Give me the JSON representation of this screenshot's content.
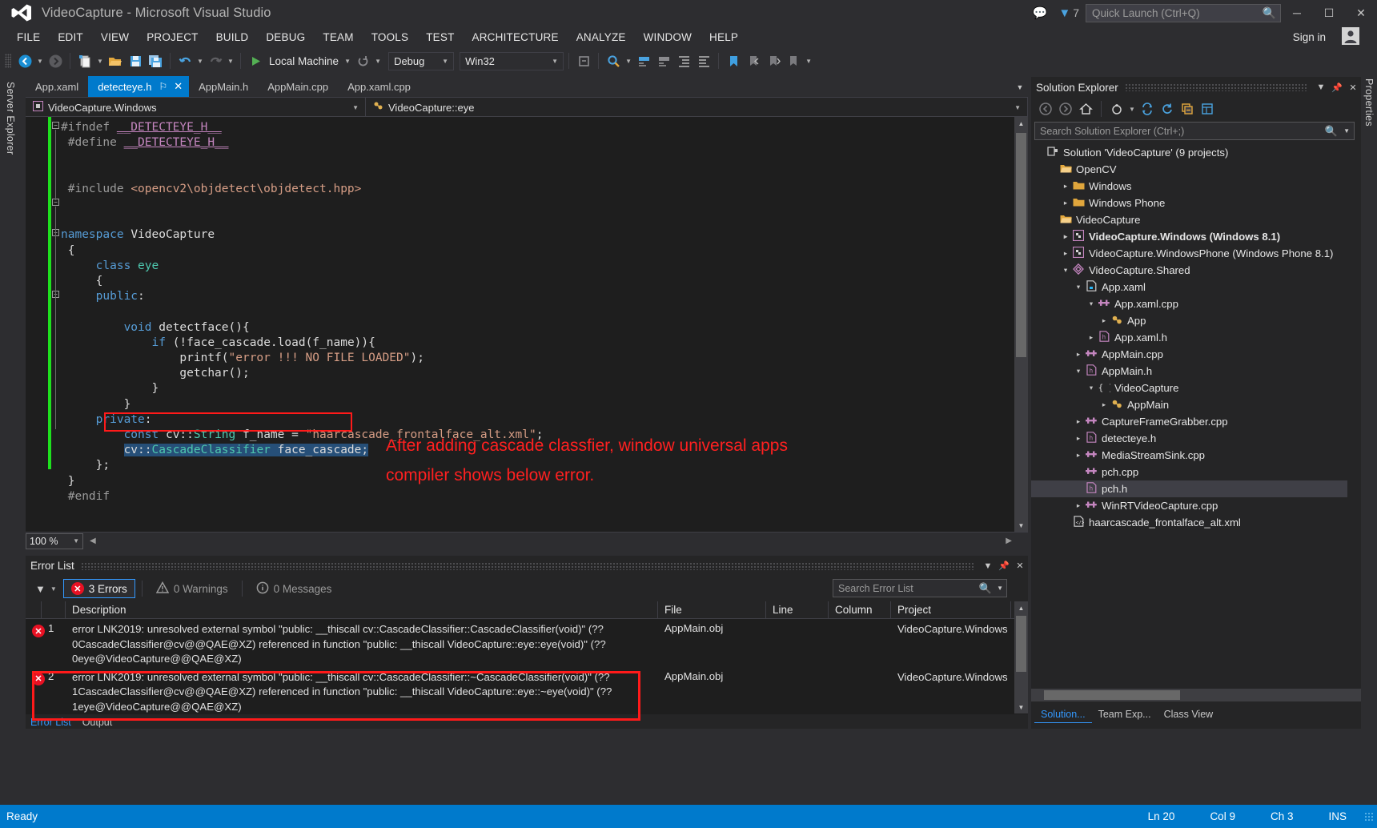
{
  "window": {
    "title": "VideoCapture - Microsoft Visual Studio",
    "logo_icon": "visual-studio-logo",
    "feedback_icon": "feedback-icon",
    "notification_icon": "notification-funnel-icon",
    "notification_count": "7",
    "minimize": "─",
    "maximize": "☐",
    "close": "✕",
    "sign_in": "Sign in",
    "user_icon": "user-account-icon"
  },
  "quick_launch": {
    "placeholder": "Quick Launch (Ctrl+Q)",
    "search_icon": "magnifier-icon"
  },
  "menu": {
    "items": [
      "FILE",
      "EDIT",
      "VIEW",
      "PROJECT",
      "BUILD",
      "DEBUG",
      "TEAM",
      "TOOLS",
      "TEST",
      "ARCHITECTURE",
      "ANALYZE",
      "WINDOW",
      "HELP"
    ]
  },
  "toolbar": {
    "nav_back_icon": "navigate-back-icon",
    "nav_forward_icon": "navigate-forward-icon",
    "new_project_icon": "new-project-icon",
    "open_file_icon": "open-file-icon",
    "save_icon": "save-icon",
    "save_all_icon": "save-all-icon",
    "undo_icon": "undo-icon",
    "redo_icon": "redo-icon",
    "start_icon": "start-debug-play-icon",
    "start_label": "Local Machine",
    "restart_icon": "restart-icon",
    "config_value": "Debug",
    "platform_value": "Win32",
    "step_icon": "step-into-icon",
    "find_icon": "find-in-files-icon",
    "comment_icon": "comment-icon",
    "uncomment_icon": "uncomment-icon",
    "indent_icon": "indent-icon",
    "outdent_icon": "outdent-icon",
    "bookmark_icon": "bookmark-icon",
    "bm_prev_icon": "bookmark-prev-icon",
    "bm_next_icon": "bookmark-next-icon",
    "bm_clear_icon": "bookmark-clear-icon",
    "overflow_icon": "toolbar-overflow-icon"
  },
  "rails": {
    "server_explorer": "Server Explorer",
    "properties": "Properties"
  },
  "tabs": {
    "items": [
      {
        "label": "App.xaml",
        "active": false
      },
      {
        "label": "detecteye.h",
        "active": true,
        "pin_icon": "pin-icon",
        "close_icon": "close-icon"
      },
      {
        "label": "AppMain.h",
        "active": false
      },
      {
        "label": "AppMain.cpp",
        "active": false
      },
      {
        "label": "App.xaml.cpp",
        "active": false
      }
    ],
    "overflow_icon": "tab-overflow-chevron-icon"
  },
  "navbar": {
    "project_icon": "project-icon",
    "project": "VideoCapture.Windows",
    "member_icon": "class-icon",
    "member": "VideoCapture::eye",
    "chevron_icon": "chevron-down-icon"
  },
  "editor": {
    "zoom": "100 %",
    "zoom_chevron_icon": "chevron-down-icon",
    "split_icon": "split-view-icon",
    "scroll_up_icon": "scroll-up-arrow",
    "scroll_down_icon": "scroll-down-arrow",
    "hscroll_left_icon": "scroll-left-arrow",
    "hscroll_right_icon": "scroll-right-arrow",
    "annotation_line1": "After adding cascade classfier, window universal apps",
    "annotation_line2": "compiler shows below error.",
    "code_lines": [
      "#ifndef __DETECTEYE_H__",
      "#define __DETECTEYE_H__",
      "",
      "#include <opencv2\\objdetect\\objdetect.hpp>",
      "",
      "namespace VideoCapture",
      "{",
      "    class eye",
      "    {",
      "    public:",
      "",
      "        void detectface(){",
      "            if (!face_cascade.load(f_name)){",
      "                printf(\"error !!! NO FILE LOADED\");",
      "                getchar();",
      "            }",
      "        }",
      "    private:",
      "        const cv::String f_name = \"haarcascade_frontalface_alt.xml\";",
      "        cv::CascadeClassifier face_cascade;",
      "    };",
      "}",
      "#endif"
    ],
    "selected_line": "cv::CascadeClassifier face_cascade;"
  },
  "error_list": {
    "title": "Error List",
    "chevron_icon": "chevron-down-icon",
    "pin_icon": "pin-icon",
    "close_icon": "close-icon",
    "filter_icon": "filter-funnel-icon",
    "filter_chevron_icon": "chevron-down-icon",
    "errors_icon": "error-circle-icon",
    "errors_label": "3 Errors",
    "warnings_icon": "warning-triangle-icon",
    "warnings_label": "0 Warnings",
    "messages_icon": "info-circle-icon",
    "messages_label": "0 Messages",
    "search_placeholder": "Search Error List",
    "search_icon": "magnifier-icon",
    "search_chevron_icon": "chevron-down-icon",
    "columns": [
      "",
      "",
      "Description",
      "File",
      "Line",
      "Column",
      "Project"
    ],
    "rows": [
      {
        "icon": "error-circle-icon",
        "num": "1",
        "description": "error LNK2019: unresolved external symbol \"public: __thiscall cv::CascadeClassifier::CascadeClassifier(void)\" (??0CascadeClassifier@cv@@QAE@XZ) referenced in function \"public: __thiscall VideoCapture::eye::eye(void)\" (??0eye@VideoCapture@@QAE@XZ)",
        "file": "AppMain.obj",
        "line": "",
        "column": "",
        "project": "VideoCapture.Windows"
      },
      {
        "icon": "error-circle-icon",
        "num": "2",
        "description": "error LNK2019: unresolved external symbol \"public: __thiscall cv::CascadeClassifier::~CascadeClassifier(void)\" (??1CascadeClassifier@cv@@QAE@XZ) referenced in function \"public: __thiscall VideoCapture::eye::~eye(void)\" (??1eye@VideoCapture@@QAE@XZ)",
        "file": "AppMain.obj",
        "line": "",
        "column": "",
        "project": "VideoCapture.Windows"
      }
    ],
    "footer_tabs": [
      {
        "label": "Error List",
        "active": true
      },
      {
        "label": "Output",
        "active": false
      }
    ]
  },
  "solution_explorer": {
    "title": "Solution Explorer",
    "chevron_icon": "chevron-down-icon",
    "pin_icon": "pin-icon",
    "close_icon": "close-icon",
    "toolbar": {
      "back_icon": "navigate-back-icon",
      "forward_icon": "navigate-forward-icon",
      "home_icon": "home-icon",
      "pending_changes_icon": "pending-changes-icon",
      "pending_chevron_icon": "chevron-down-icon",
      "sync_icon": "sync-with-active-document-icon",
      "refresh_icon": "refresh-icon",
      "collapse_icon": "collapse-all-icon",
      "properties_icon": "show-properties-icon"
    },
    "search_placeholder": "Search Solution Explorer (Ctrl+;)",
    "search_icon": "magnifier-icon",
    "search_chevron_icon": "chevron-down-icon",
    "tree": [
      {
        "indent": 0,
        "arrow": "",
        "icon": "solution-icon",
        "label": "Solution 'VideoCapture' (9 projects)",
        "bold": false,
        "selected": false
      },
      {
        "indent": 1,
        "arrow": "",
        "icon": "solution-folder-icon",
        "label": "OpenCV",
        "bold": false,
        "selected": false
      },
      {
        "indent": 2,
        "arrow": "▸",
        "icon": "folder-icon",
        "label": "Windows",
        "bold": false,
        "selected": false
      },
      {
        "indent": 2,
        "arrow": "▸",
        "icon": "folder-icon",
        "label": "Windows Phone",
        "bold": false,
        "selected": false
      },
      {
        "indent": 1,
        "arrow": "",
        "icon": "solution-folder-icon",
        "label": "VideoCapture",
        "bold": false,
        "selected": false
      },
      {
        "indent": 2,
        "arrow": "▸",
        "icon": "cpp-project-icon",
        "label": "VideoCapture.Windows (Windows 8.1)",
        "bold": true,
        "selected": false
      },
      {
        "indent": 2,
        "arrow": "▸",
        "icon": "cpp-project-icon",
        "label": "VideoCapture.WindowsPhone (Windows Phone 8.1)",
        "bold": false,
        "selected": false
      },
      {
        "indent": 2,
        "arrow": "▾",
        "icon": "shared-project-icon",
        "label": "VideoCapture.Shared",
        "bold": false,
        "selected": false
      },
      {
        "indent": 3,
        "arrow": "▾",
        "icon": "xaml-file-icon",
        "label": "App.xaml",
        "bold": false,
        "selected": false
      },
      {
        "indent": 4,
        "arrow": "▾",
        "icon": "cpp-file-icon",
        "label": "App.xaml.cpp",
        "bold": false,
        "selected": false
      },
      {
        "indent": 5,
        "arrow": "▸",
        "icon": "class-member-icon",
        "label": "App",
        "bold": false,
        "selected": false
      },
      {
        "indent": 4,
        "arrow": "▸",
        "icon": "header-file-icon",
        "label": "App.xaml.h",
        "bold": false,
        "selected": false
      },
      {
        "indent": 3,
        "arrow": "▸",
        "icon": "cpp-file-icon",
        "label": "AppMain.cpp",
        "bold": false,
        "selected": false
      },
      {
        "indent": 3,
        "arrow": "▾",
        "icon": "header-file-icon",
        "label": "AppMain.h",
        "bold": false,
        "selected": false
      },
      {
        "indent": 4,
        "arrow": "▾",
        "icon": "namespace-icon",
        "label": "VideoCapture",
        "bold": false,
        "selected": false
      },
      {
        "indent": 5,
        "arrow": "▸",
        "icon": "class-member-icon",
        "label": "AppMain",
        "bold": false,
        "selected": false
      },
      {
        "indent": 3,
        "arrow": "▸",
        "icon": "cpp-file-icon",
        "label": "CaptureFrameGrabber.cpp",
        "bold": false,
        "selected": false
      },
      {
        "indent": 3,
        "arrow": "▸",
        "icon": "header-file-icon",
        "label": "detecteye.h",
        "bold": false,
        "selected": false
      },
      {
        "indent": 3,
        "arrow": "▸",
        "icon": "cpp-file-icon",
        "label": "MediaStreamSink.cpp",
        "bold": false,
        "selected": false
      },
      {
        "indent": 3,
        "arrow": "",
        "icon": "cpp-file-icon",
        "label": "pch.cpp",
        "bold": false,
        "selected": false
      },
      {
        "indent": 3,
        "arrow": "",
        "icon": "header-file-icon",
        "label": "pch.h",
        "bold": false,
        "selected": true
      },
      {
        "indent": 3,
        "arrow": "▸",
        "icon": "cpp-file-icon",
        "label": "WinRTVideoCapture.cpp",
        "bold": false,
        "selected": false
      },
      {
        "indent": 2,
        "arrow": "",
        "icon": "xml-file-icon",
        "label": "haarcascade_frontalface_alt.xml",
        "bold": false,
        "selected": false
      }
    ],
    "bottom_tabs": [
      {
        "label": "Solution...",
        "active": true
      },
      {
        "label": "Team Exp...",
        "active": false
      },
      {
        "label": "Class View",
        "active": false
      }
    ]
  },
  "status_bar": {
    "ready": "Ready",
    "line": "Ln 20",
    "col": "Col 9",
    "ch": "Ch 3",
    "ins": "INS",
    "grip_icon": "resize-grip-icon"
  },
  "colors": {
    "accent": "#007acc",
    "error": "#e81123",
    "annotation": "#ff2020",
    "editor_bg": "#1e1e1e",
    "chrome_bg": "#2d2d30",
    "changebar_green": "#1ee01e"
  }
}
